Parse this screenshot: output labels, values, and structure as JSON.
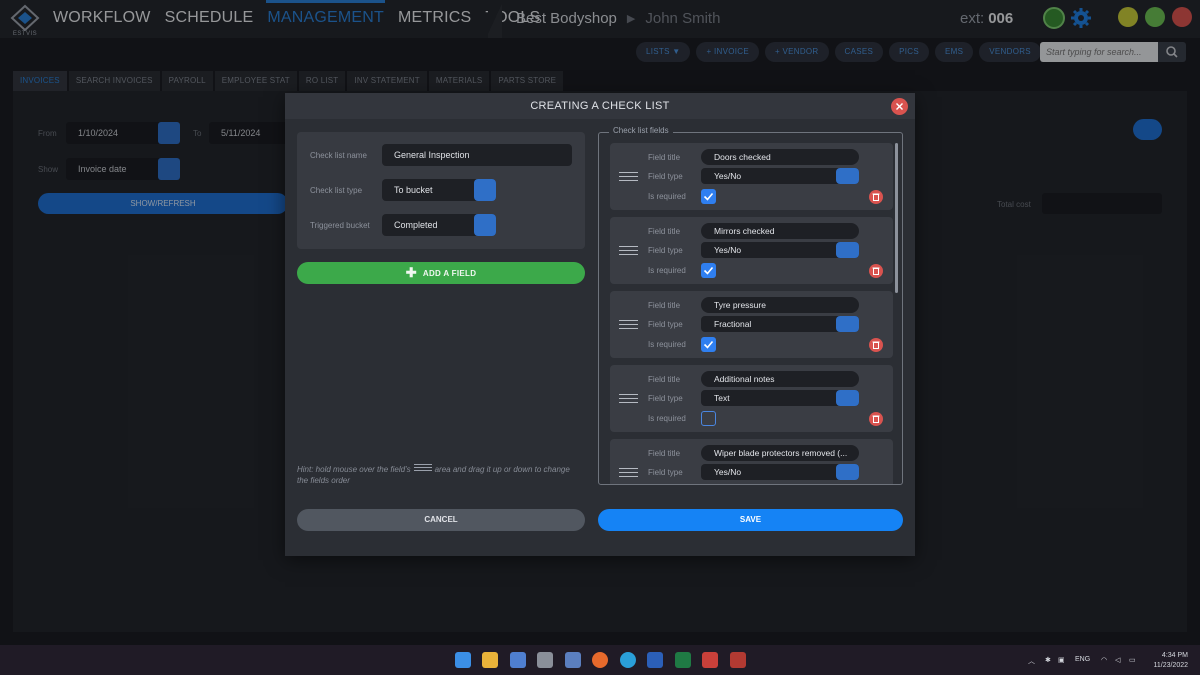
{
  "app": {
    "logo_text": "ESTVIS"
  },
  "main_nav": [
    {
      "label": "WORKFLOW",
      "active": false
    },
    {
      "label": "SCHEDULE",
      "active": false
    },
    {
      "label": "MANAGEMENT",
      "active": true
    },
    {
      "label": "METRICS",
      "active": false
    },
    {
      "label": "TOOLS",
      "active": false
    }
  ],
  "breadcrumb": {
    "shop": "Best Bodyshop",
    "user": "John Smith"
  },
  "ext": {
    "label": "ext:",
    "value": "006"
  },
  "toolbar": {
    "pills": [
      "LISTS ▼",
      "+ INVOICE",
      "+ VENDOR",
      "CASES",
      "PICS",
      "EMS",
      "VENDORS"
    ],
    "search_placeholder": "Start typing for search..."
  },
  "subtabs": [
    {
      "label": "INVOICES",
      "active": true
    },
    {
      "label": "SEARCH INVOICES",
      "active": false
    },
    {
      "label": "PAYROLL",
      "active": false
    },
    {
      "label": "EMPLOYEE STAT",
      "active": false
    },
    {
      "label": "RO LIST",
      "active": false
    },
    {
      "label": "INV STATEMENT",
      "active": false
    },
    {
      "label": "MATERIALS",
      "active": false
    },
    {
      "label": "PARTS STORE",
      "active": false
    }
  ],
  "filters": {
    "from_label": "From",
    "from_value": "1/10/2024",
    "to_label": "To",
    "to_value": "5/11/2024",
    "show_label": "Show",
    "show_value": "Invoice date",
    "refresh_label": "SHOW/REFRESH",
    "total_cost_label": "Total cost"
  },
  "modal": {
    "title": "CREATING A CHECK LIST",
    "name_label": "Check list name",
    "name_value": "General Inspection",
    "type_label": "Check list type",
    "type_value": "To bucket",
    "bucket_label": "Triggered bucket",
    "bucket_value": "Completed",
    "add_field_label": "ADD A FIELD",
    "hint_before": "Hint: hold mouse over the field's",
    "hint_after": "area and drag it up or down to change the fields order",
    "fields_legend": "Check list fields",
    "field_title_label": "Field title",
    "field_type_label": "Field type",
    "required_label": "Is required",
    "fields": [
      {
        "title": "Doors checked",
        "type": "Yes/No",
        "required": true
      },
      {
        "title": "Mirrors checked",
        "type": "Yes/No",
        "required": true
      },
      {
        "title": "Tyre pressure",
        "type": "Fractional",
        "required": true
      },
      {
        "title": "Additional notes",
        "type": "Text",
        "required": false
      },
      {
        "title": "Wiper blade protectors removed (...",
        "type": "Yes/No",
        "required": null
      }
    ],
    "cancel_label": "CANCEL",
    "save_label": "SAVE"
  },
  "taskbar": {
    "lang": "ENG",
    "time": "4:34 PM",
    "date": "11/23/2022"
  },
  "colors": {
    "accent": "#2a7fd4",
    "save": "#1583f5",
    "add": "#3ca94a",
    "danger": "#d9534f"
  }
}
